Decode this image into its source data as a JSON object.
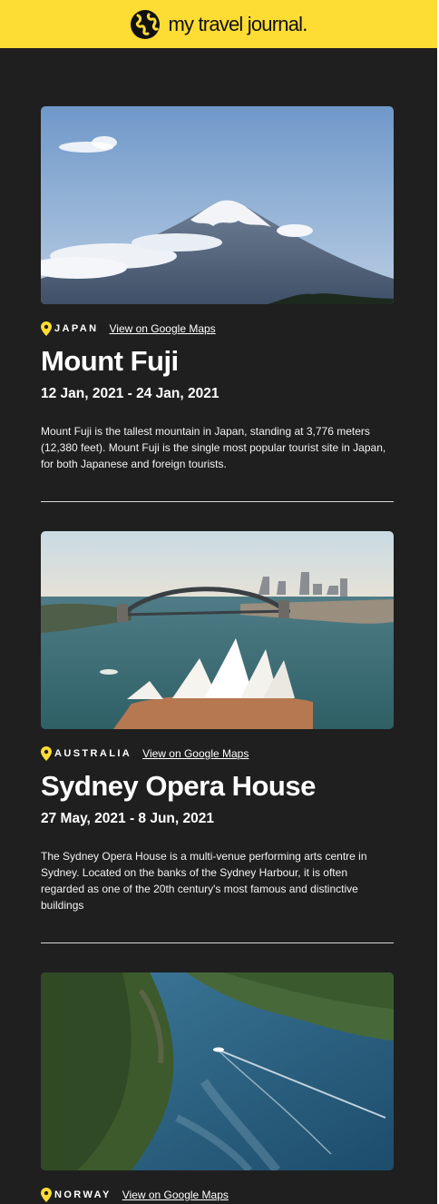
{
  "header": {
    "brand": "my travel journal.",
    "logo_icon": "globe-icon",
    "background": "#fddc34"
  },
  "entries": [
    {
      "country": "JAPAN",
      "maps_link": "View on Google Maps",
      "title": "Mount Fuji",
      "dates": "12 Jan, 2021 - 24 Jan, 2021",
      "description": "Mount Fuji is the tallest mountain in Japan, standing at 3,776 meters (12,380 feet). Mount Fuji is the single most popular tourist site in Japan, for both Japanese and foreign tourists."
    },
    {
      "country": "AUSTRALIA",
      "maps_link": "View on Google Maps",
      "title": "Sydney Opera House",
      "dates": "27 May, 2021 - 8 Jun, 2021",
      "description": "The Sydney Opera House is a multi-venue performing arts centre in Sydney. Located on the banks of the Sydney Harbour, it is often regarded as one of the 20th century's most famous and distinctive buildings"
    },
    {
      "country": "NORWAY",
      "maps_link": "View on Google Maps"
    }
  ]
}
